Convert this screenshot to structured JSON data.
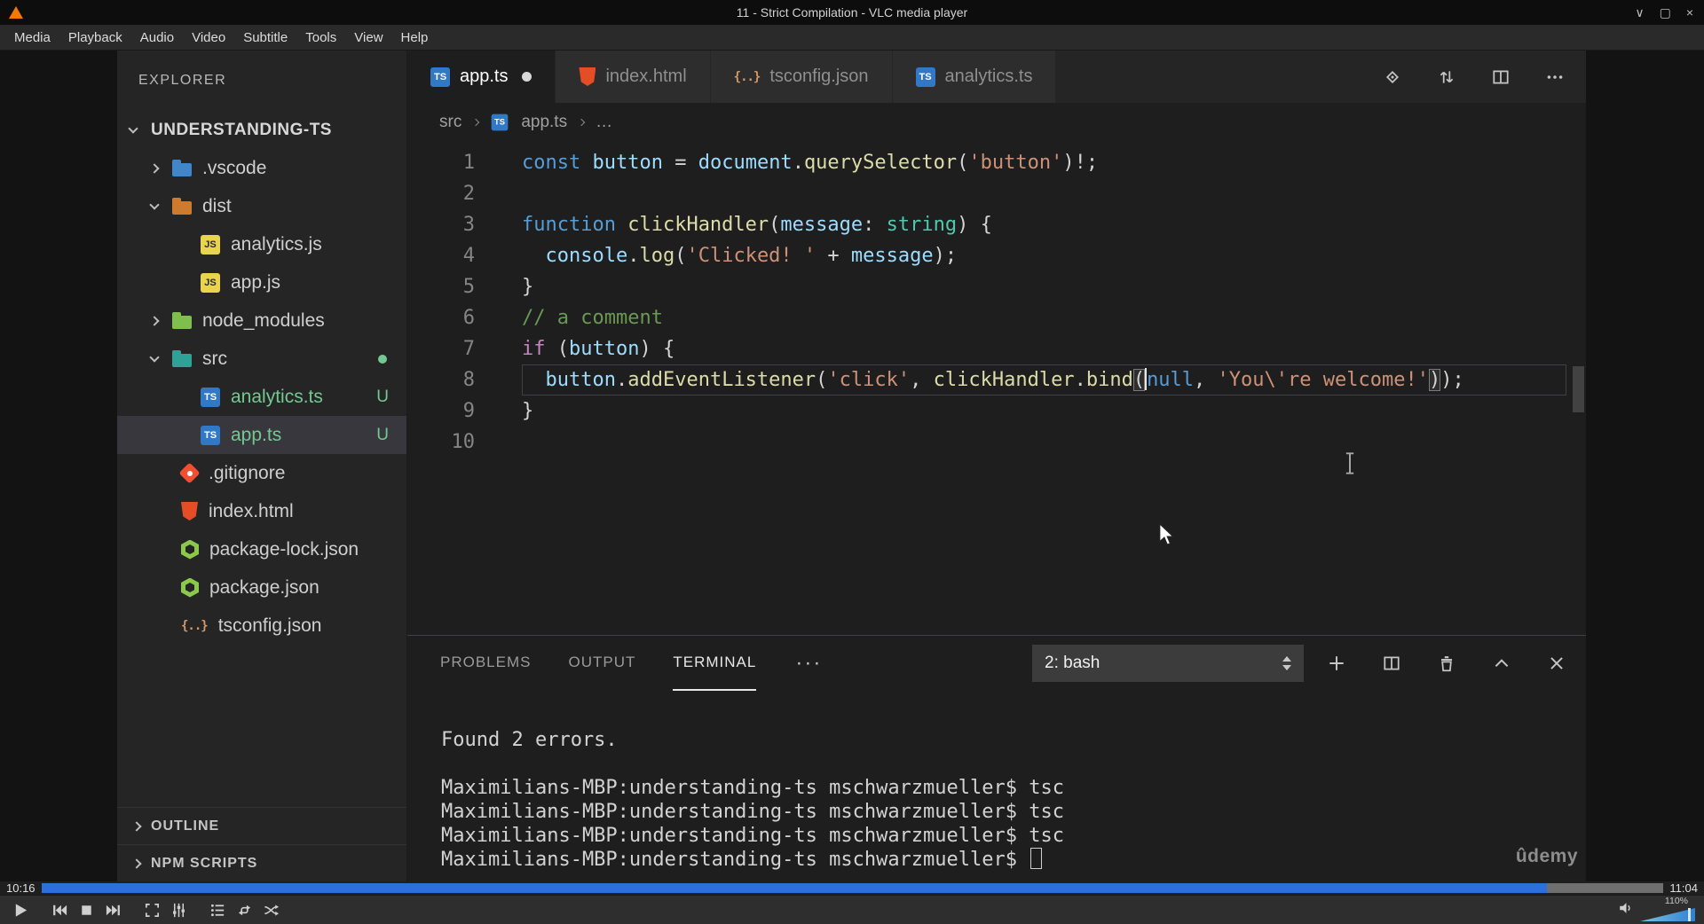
{
  "vlc": {
    "title": "11 - Strict Compilation - VLC media player",
    "menu": [
      "Media",
      "Playback",
      "Audio",
      "Video",
      "Subtitle",
      "Tools",
      "View",
      "Help"
    ],
    "window_buttons": [
      {
        "name": "shade-window",
        "glyph": "∨"
      },
      {
        "name": "maximize-window",
        "glyph": "▢"
      },
      {
        "name": "close-window",
        "glyph": "×"
      }
    ],
    "controls": [
      {
        "name": "play"
      },
      {
        "name": "previous",
        "gap": true
      },
      {
        "name": "stop"
      },
      {
        "name": "next"
      },
      {
        "name": "fullscreen",
        "gap": true
      },
      {
        "name": "extended-settings"
      },
      {
        "name": "playlist",
        "gap": true
      },
      {
        "name": "loop"
      },
      {
        "name": "random"
      }
    ],
    "time_elapsed": "10:16",
    "time_total": "11:04",
    "progress_pct": 92.8,
    "volume_label": "110%"
  },
  "vscode": {
    "icon_glyphs": {
      "ts": "TS",
      "js": "JS",
      "json-braces": "{..}",
      "ellipsis": "···"
    },
    "explorer": {
      "header": "EXPLORER",
      "items": [
        {
          "label": "UNDERSTANDING-TS",
          "indent": 0,
          "chevron": "down",
          "root": true
        },
        {
          "label": ".vscode",
          "indent": 1,
          "chevron": "right",
          "icon": "folder-vscode"
        },
        {
          "label": "dist",
          "indent": 1,
          "chevron": "down",
          "icon": "folder-dist"
        },
        {
          "label": "analytics.js",
          "indent": 2,
          "icon": "js"
        },
        {
          "label": "app.js",
          "indent": 2,
          "icon": "js"
        },
        {
          "label": "node_modules",
          "indent": 1,
          "chevron": "right",
          "icon": "folder-node"
        },
        {
          "label": "src",
          "indent": 1,
          "chevron": "down",
          "icon": "folder-src",
          "dot": true
        },
        {
          "label": "analytics.ts",
          "indent": 2,
          "icon": "ts",
          "badge": "U",
          "git": "untracked"
        },
        {
          "label": "app.ts",
          "indent": 2,
          "icon": "ts",
          "badge": "U",
          "git": "untracked",
          "selected": true
        },
        {
          "label": ".gitignore",
          "indent": 1,
          "icon": "git"
        },
        {
          "label": "index.html",
          "indent": 1,
          "icon": "html"
        },
        {
          "label": "package-lock.json",
          "indent": 1,
          "icon": "node"
        },
        {
          "label": "package.json",
          "indent": 1,
          "icon": "node"
        },
        {
          "label": "tsconfig.json",
          "indent": 1,
          "icon": "json-braces"
        }
      ],
      "outline_label": "OUTLINE",
      "npm_label": "NPM SCRIPTS"
    },
    "tabs": [
      {
        "label": "app.ts",
        "icon": "ts",
        "active": true,
        "dirty": true
      },
      {
        "label": "index.html",
        "icon": "html"
      },
      {
        "label": "tsconfig.json",
        "icon": "json-braces"
      },
      {
        "label": "analytics.ts",
        "icon": "ts"
      }
    ],
    "breadcrumb": [
      "src",
      "app.ts",
      "…"
    ],
    "editor": {
      "current_line": 8,
      "lines": [
        [
          [
            "const ",
            "kw"
          ],
          [
            "button",
            "var"
          ],
          [
            " = ",
            "fg"
          ],
          [
            "document",
            "var"
          ],
          [
            ".",
            "fg"
          ],
          [
            "querySelector",
            "fn"
          ],
          [
            "(",
            "fg"
          ],
          [
            "'button'",
            "str"
          ],
          [
            ")!;",
            "fg"
          ]
        ],
        [],
        [
          [
            "function ",
            "kw"
          ],
          [
            "clickHandler",
            "fn"
          ],
          [
            "(",
            "fg"
          ],
          [
            "message",
            "var"
          ],
          [
            ": ",
            "fg"
          ],
          [
            "string",
            "type"
          ],
          [
            ") {",
            "fg"
          ]
        ],
        [
          [
            "  ",
            "fg"
          ],
          [
            "console",
            "var"
          ],
          [
            ".",
            "fg"
          ],
          [
            "log",
            "fn"
          ],
          [
            "(",
            "fg"
          ],
          [
            "'Clicked! '",
            "str"
          ],
          [
            " + ",
            "fg"
          ],
          [
            "message",
            "var"
          ],
          [
            ");",
            "fg"
          ]
        ],
        [
          [
            "}",
            "fg"
          ]
        ],
        [
          [
            "// a comment",
            "com"
          ]
        ],
        [
          [
            "if",
            "ctrl"
          ],
          [
            " (",
            "fg"
          ],
          [
            "button",
            "var"
          ],
          [
            ") {",
            "fg"
          ]
        ],
        [
          [
            "  ",
            "fg"
          ],
          [
            "button",
            "var"
          ],
          [
            ".",
            "fg"
          ],
          [
            "addEventListener",
            "fn"
          ],
          [
            "(",
            "fg"
          ],
          [
            "'click'",
            "str"
          ],
          [
            ", ",
            "fg"
          ],
          [
            "clickHandler",
            "fn"
          ],
          [
            ".",
            "fg"
          ],
          [
            "bind",
            "fn"
          ],
          [
            "(",
            "hl"
          ],
          [
            "",
            "cursor"
          ],
          [
            "null",
            "kw"
          ],
          [
            ", ",
            "fg"
          ],
          [
            "'You\\'re welcome!'",
            "str"
          ],
          [
            ")",
            "hl"
          ],
          [
            ");",
            "fg"
          ]
        ],
        [
          [
            "}",
            "fg"
          ]
        ],
        []
      ]
    },
    "panel": {
      "tabs": [
        "PROBLEMS",
        "OUTPUT",
        "TERMINAL"
      ],
      "active_tab": "TERMINAL",
      "shell_select": "2: bash",
      "terminal_lines": [
        "Found 2 errors.",
        "",
        "Maximilians-MBP:understanding-ts mschwarzmueller$ tsc",
        "Maximilians-MBP:understanding-ts mschwarzmueller$ tsc",
        "Maximilians-MBP:understanding-ts mschwarzmueller$ tsc",
        "Maximilians-MBP:understanding-ts mschwarzmueller$ "
      ]
    },
    "watermark": "ûdemy"
  },
  "colors": {
    "accent_blue": "#2a72d9",
    "untracked_green": "#73C991",
    "keyword": "#569CD6",
    "control": "#C586C0",
    "variable": "#9CDCFE",
    "function": "#DCDCAA",
    "string": "#CE9178",
    "type": "#4EC9B0",
    "comment": "#6A9955",
    "editor_bg": "#1e1e1e",
    "sidebar_bg": "#252526"
  }
}
